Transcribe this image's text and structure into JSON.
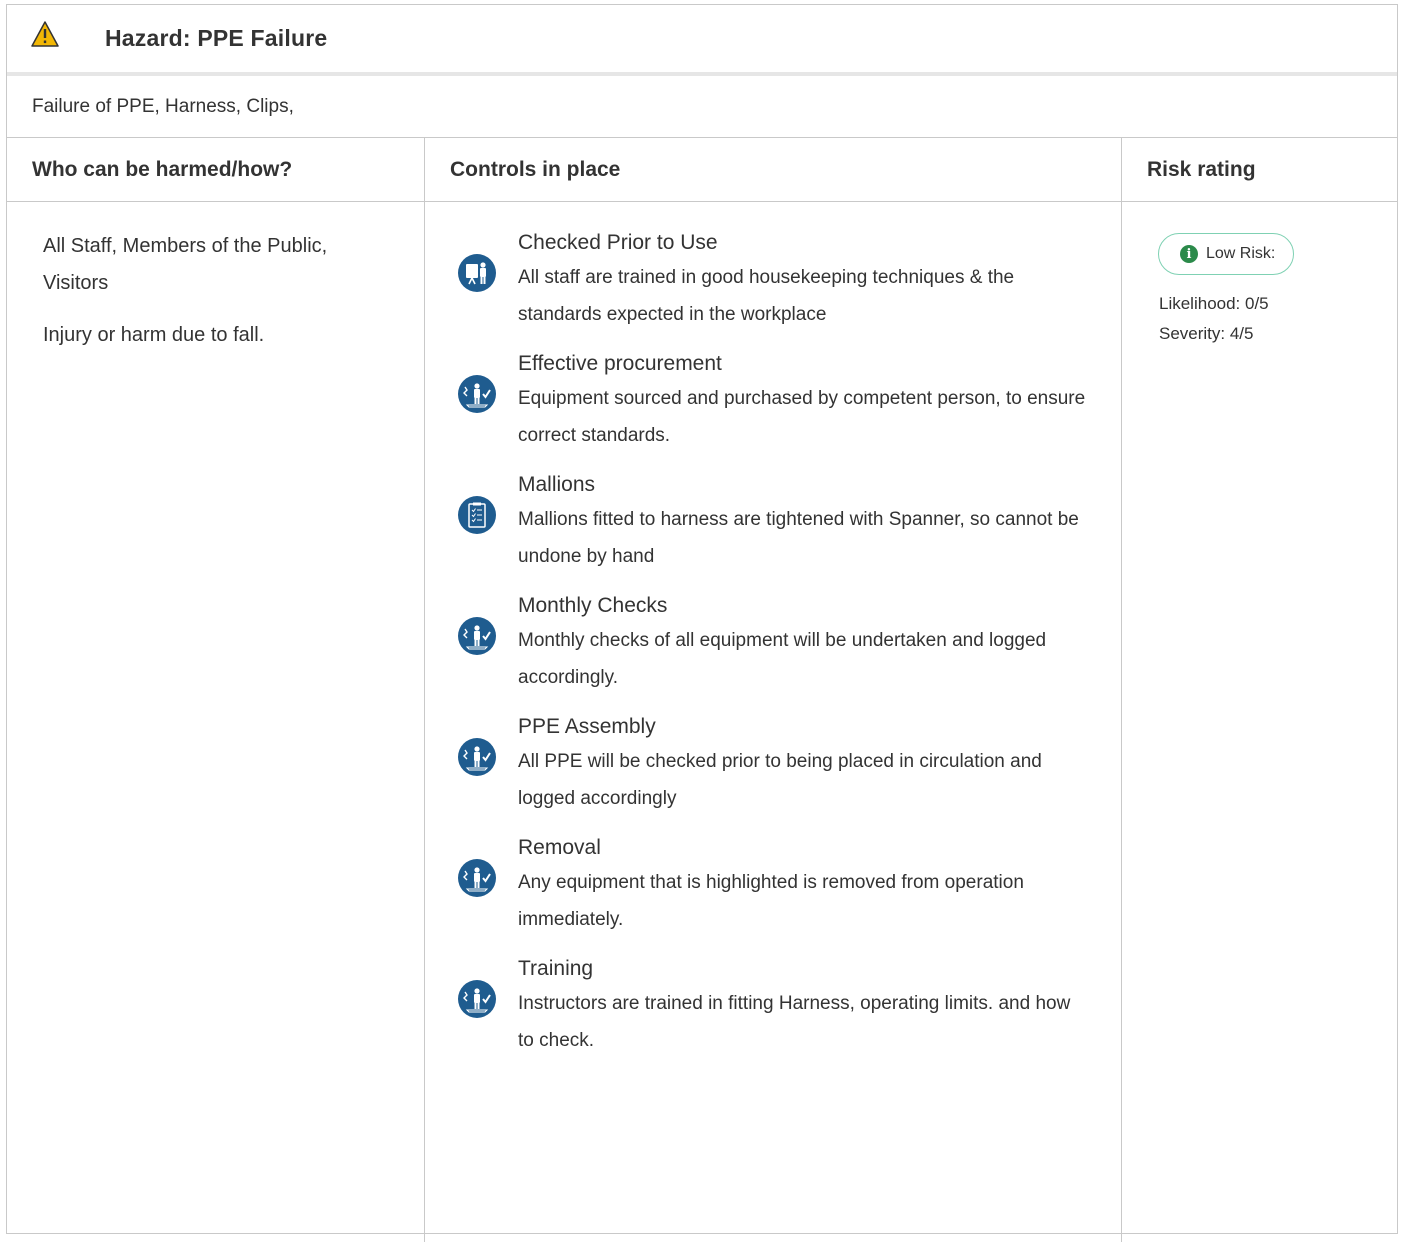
{
  "hazard": {
    "title": "Hazard:  PPE Failure",
    "description": "Failure of PPE, Harness, Clips,",
    "icon": "warning-triangle-icon"
  },
  "table": {
    "headers": {
      "who": "Who can be harmed/how?",
      "controls": "Controls in place",
      "risk": "Risk rating"
    },
    "who": {
      "people": "All Staff, Members of the Public, Visitors",
      "how": "Injury or harm due to fall."
    },
    "controls": [
      {
        "title": "Checked Prior to Use",
        "text": "All staff are trained in good housekeeping techniques & the standards expected in the workplace",
        "icon": "training-presenter-icon"
      },
      {
        "title": "Effective procurement",
        "text": "Equipment sourced and purchased by competent person, to ensure correct standards.",
        "icon": "competent-person-icon"
      },
      {
        "title": "Mallions",
        "text": "Mallions fitted to harness are tightened with Spanner, so cannot be undone by hand",
        "icon": "clipboard-checklist-icon"
      },
      {
        "title": "Monthly Checks",
        "text": "Monthly checks of all equipment will be undertaken and logged accordingly.",
        "icon": "competent-person-icon"
      },
      {
        "title": "PPE Assembly",
        "text": "All PPE will be checked prior to being placed in circulation and logged accordingly",
        "icon": "competent-person-icon"
      },
      {
        "title": "Removal",
        "text": "Any equipment that is highlighted is removed from operation immediately.",
        "icon": "competent-person-icon"
      },
      {
        "title": "Training",
        "text": "Instructors are trained in fitting Harness, operating limits. and how to check.",
        "icon": "competent-person-icon"
      }
    ],
    "risk": {
      "badge": "Low Risk:",
      "likelihood": "Likelihood: 0/5",
      "severity": "Severity: 4/5",
      "icon": "info-icon",
      "badge_border_color": "#7fd1b3",
      "info_color": "#2b8a4a"
    }
  },
  "colors": {
    "icon_blue": "#1f5c8f",
    "warning_yellow": "#f2b705",
    "border": "#c9c9c9"
  }
}
